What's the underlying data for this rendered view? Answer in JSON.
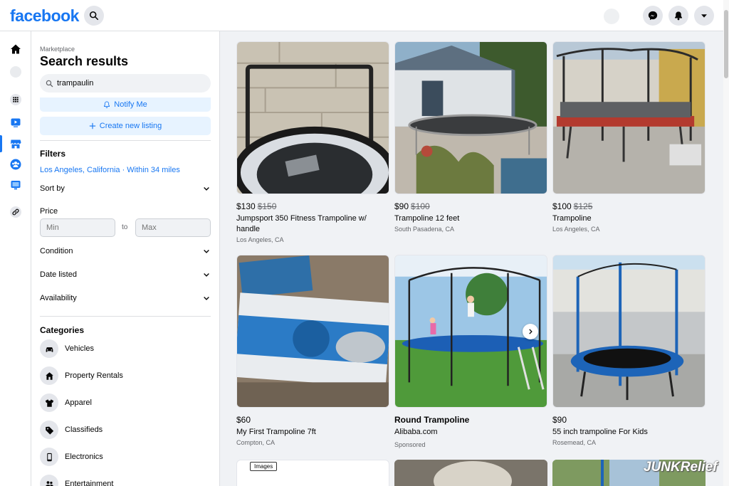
{
  "header": {
    "logo": "facebook",
    "icons": [
      "search-icon",
      "messenger-icon",
      "bell-icon",
      "caret-down-icon"
    ]
  },
  "rail": {
    "icons": [
      "home-icon",
      "profile-icon",
      "apps-icon",
      "watch-icon",
      "marketplace-icon",
      "groups-icon",
      "gaming-icon",
      "link-icon"
    ]
  },
  "sidebar": {
    "breadcrumb": "Marketplace",
    "title": "Search results",
    "search_value": "trampaulin",
    "notify_label": "Notify Me",
    "create_label": "Create new listing",
    "filters_heading": "Filters",
    "location": "Los Angeles, California · Within 34 miles",
    "sort_by": "Sort by",
    "price_label": "Price",
    "min_placeholder": "Min",
    "to_label": "to",
    "max_placeholder": "Max",
    "condition": "Condition",
    "date_listed": "Date listed",
    "availability": "Availability",
    "categories_heading": "Categories",
    "categories": [
      {
        "label": "Vehicles",
        "icon": "car-icon"
      },
      {
        "label": "Property Rentals",
        "icon": "house-icon"
      },
      {
        "label": "Apparel",
        "icon": "shirt-icon"
      },
      {
        "label": "Classifieds",
        "icon": "tag-icon"
      },
      {
        "label": "Electronics",
        "icon": "phone-icon"
      },
      {
        "label": "Entertainment",
        "icon": "people-icon"
      }
    ]
  },
  "listings": [
    {
      "price": "$130",
      "old_price": "$150",
      "title": "Jumpsport 350 Fitness Trampoline w/ handle",
      "location": "Los Angeles, CA"
    },
    {
      "price": "$90",
      "old_price": "$100",
      "title": "Trampoline 12 feet",
      "location": "South Pasadena, CA"
    },
    {
      "price": "$100",
      "old_price": "$125",
      "title": "Trampoline",
      "location": "Los Angeles, CA"
    },
    {
      "price": "$60",
      "old_price": "",
      "title": "My First Trampoline 7ft",
      "location": "Compton, CA"
    },
    {
      "price": "Round Trampoline",
      "old_price": "",
      "title": "Alibaba.com",
      "location": "Sponsored"
    },
    {
      "price": "$90",
      "old_price": "",
      "title": "55 inch trampoline For Kids",
      "location": "Rosemead, CA"
    }
  ],
  "row3": {
    "images_tag": "Images"
  },
  "watermark": "JUNKRelief",
  "colors": {
    "brand": "#1877f2",
    "background": "#f0f2f5",
    "secondary_text": "#65676b"
  }
}
